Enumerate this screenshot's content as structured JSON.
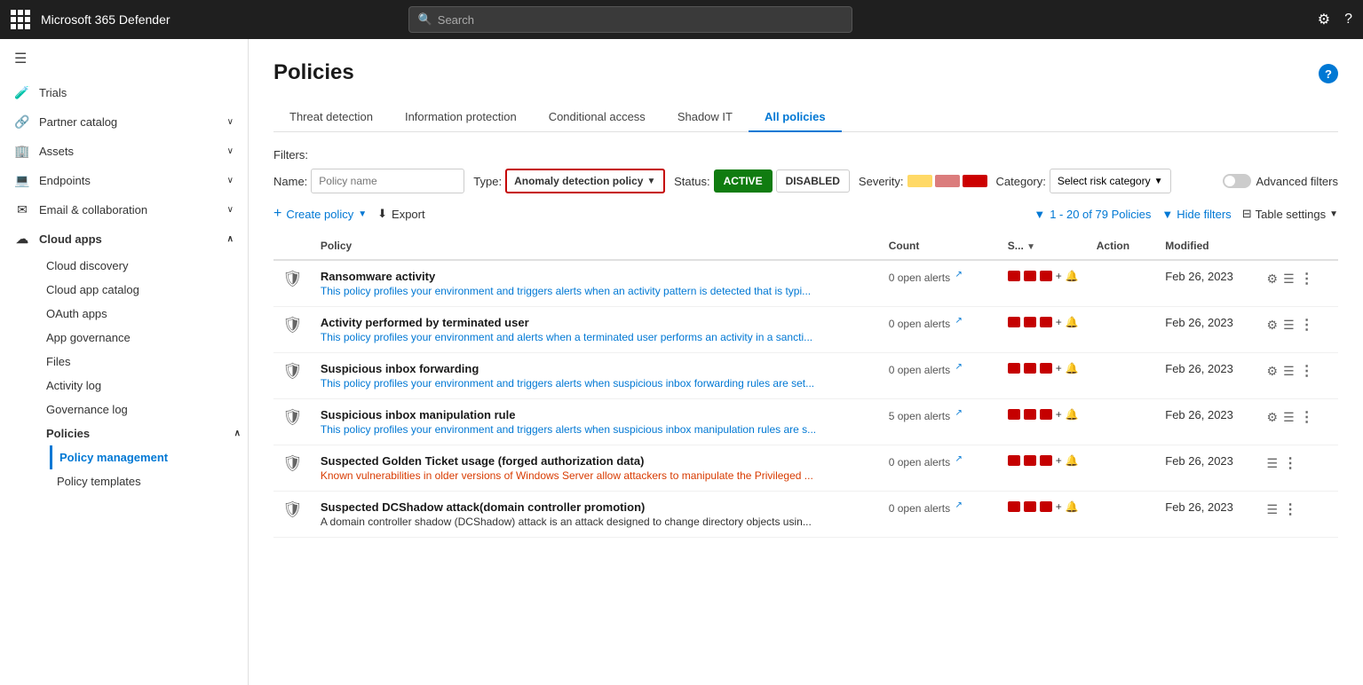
{
  "topbar": {
    "title": "Microsoft 365 Defender",
    "search_placeholder": "Search"
  },
  "sidebar": {
    "hamburger": "☰",
    "items": [
      {
        "id": "trials",
        "label": "Trials",
        "icon": "🧪",
        "indent": false
      },
      {
        "id": "partner-catalog",
        "label": "Partner catalog",
        "icon": "🔗",
        "indent": false,
        "chevron": true
      },
      {
        "id": "assets",
        "label": "Assets",
        "icon": "🏢",
        "indent": false,
        "chevron": true
      },
      {
        "id": "endpoints",
        "label": "Endpoints",
        "icon": "💻",
        "indent": false,
        "chevron": true
      },
      {
        "id": "email-collab",
        "label": "Email & collaboration",
        "icon": "✉",
        "indent": false,
        "chevron": true
      },
      {
        "id": "cloud-apps",
        "label": "Cloud apps",
        "icon": "☁",
        "indent": false,
        "chevron": true,
        "expanded": true
      },
      {
        "id": "cloud-discovery",
        "label": "Cloud discovery",
        "icon": "",
        "indent": true
      },
      {
        "id": "cloud-app-catalog",
        "label": "Cloud app catalog",
        "icon": "",
        "indent": true
      },
      {
        "id": "oauth-apps",
        "label": "OAuth apps",
        "icon": "",
        "indent": true
      },
      {
        "id": "app-governance",
        "label": "App governance",
        "icon": "",
        "indent": true
      },
      {
        "id": "files",
        "label": "Files",
        "icon": "",
        "indent": true
      },
      {
        "id": "activity-log",
        "label": "Activity log",
        "icon": "",
        "indent": true
      },
      {
        "id": "governance-log",
        "label": "Governance log",
        "icon": "",
        "indent": true
      },
      {
        "id": "policies",
        "label": "Policies",
        "icon": "",
        "indent": true,
        "expanded": true
      },
      {
        "id": "policy-management",
        "label": "Policy management",
        "icon": "",
        "indent": true,
        "active": true
      },
      {
        "id": "policy-templates",
        "label": "Policy templates",
        "icon": "",
        "indent": true
      }
    ]
  },
  "page": {
    "title": "Policies",
    "help_icon": "?",
    "tabs": [
      {
        "id": "threat-detection",
        "label": "Threat detection",
        "active": false
      },
      {
        "id": "information-protection",
        "label": "Information protection",
        "active": false
      },
      {
        "id": "conditional-access",
        "label": "Conditional access",
        "active": false
      },
      {
        "id": "shadow-it",
        "label": "Shadow IT",
        "active": false
      },
      {
        "id": "all-policies",
        "label": "All policies",
        "active": true
      }
    ],
    "filters": {
      "label": "Filters:",
      "name_label": "Name:",
      "name_placeholder": "Policy name",
      "type_label": "Type:",
      "type_value": "Anomaly detection policy",
      "status_label": "Status:",
      "status_active": "ACTIVE",
      "status_disabled": "DISABLED",
      "severity_label": "Severity:",
      "category_label": "Category:",
      "category_value": "Select risk category",
      "advanced_filters": "Advanced filters"
    },
    "toolbar": {
      "create_label": "Create policy",
      "export_label": "Export",
      "count_text": "1 - 20 of 79 Policies",
      "hide_filters": "Hide filters",
      "table_settings": "Table settings"
    },
    "table": {
      "headers": [
        "",
        "Policy",
        "Count",
        "S...",
        "Action",
        "Modified",
        ""
      ],
      "rows": [
        {
          "name": "Ransomware activity",
          "desc": "This policy profiles your environment and triggers alerts when an activity pattern is detected that is typi...",
          "desc_color": "blue",
          "count": "0 open alerts",
          "modified": "Feb 26, 2023",
          "has_gear": true,
          "has_list": true
        },
        {
          "name": "Activity performed by terminated user",
          "desc": "This policy profiles your environment and alerts when a terminated user performs an activity in a sancti...",
          "desc_color": "blue",
          "count": "0 open alerts",
          "modified": "Feb 26, 2023",
          "has_gear": true,
          "has_list": true
        },
        {
          "name": "Suspicious inbox forwarding",
          "desc": "This policy profiles your environment and triggers alerts when suspicious inbox forwarding rules are set...",
          "desc_color": "blue",
          "count": "0 open alerts",
          "modified": "Feb 26, 2023",
          "has_gear": true,
          "has_list": true
        },
        {
          "name": "Suspicious inbox manipulation rule",
          "desc": "This policy profiles your environment and triggers alerts when suspicious inbox manipulation rules are s...",
          "desc_color": "blue",
          "count": "5 open alerts",
          "modified": "Feb 26, 2023",
          "has_gear": true,
          "has_list": true
        },
        {
          "name": "Suspected Golden Ticket usage (forged authorization data)",
          "desc": "Known vulnerabilities in older versions of Windows Server allow attackers to manipulate the Privileged ...",
          "desc_color": "orange",
          "count": "0 open alerts",
          "modified": "Feb 26, 2023",
          "has_gear": false,
          "has_list": true
        },
        {
          "name": "Suspected DCShadow attack(domain controller promotion)",
          "desc": "A domain controller shadow (DCShadow) attack is an attack designed to change directory objects usin...",
          "desc_color": "dark",
          "count": "0 open alerts",
          "modified": "Feb 26, 2023",
          "has_gear": false,
          "has_list": true
        }
      ]
    }
  }
}
